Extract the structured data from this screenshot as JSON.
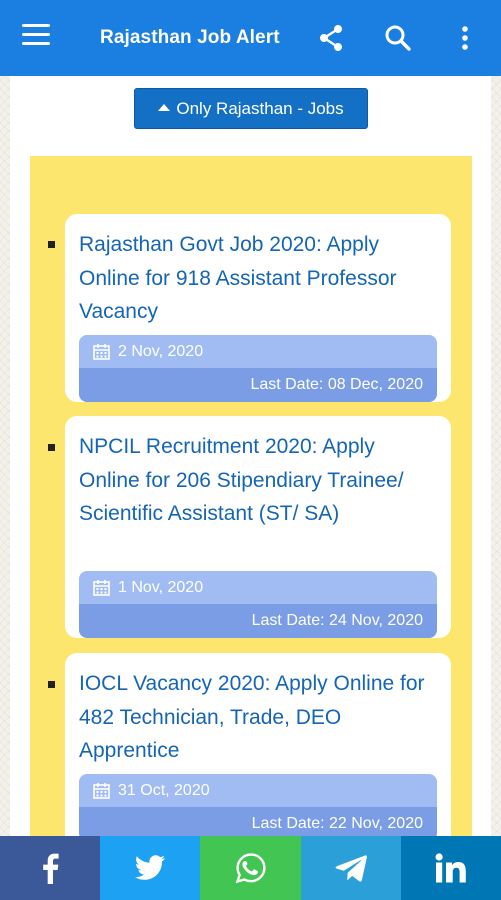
{
  "appbar": {
    "title": "Rajasthan Job Alert",
    "icons": [
      "menu-icon",
      "share-icon",
      "search-icon",
      "more-vert-icon"
    ],
    "color": "#1a7fe0"
  },
  "filter": {
    "label": "Only Rajasthan - Jobs",
    "color": "#1470c4"
  },
  "panel_color": "#fde66d",
  "jobs": [
    {
      "title": "Rajasthan Govt Job 2020: Apply Online for 918 Assistant Professor Vacancy",
      "posted": "2 Nov, 2020",
      "last_date": "Last Date: 08 Dec, 2020"
    },
    {
      "title": "NPCIL Recruitment 2020: Apply Online for 206 Stipendiary Trainee/ Scientific Assistant (ST/ SA)",
      "posted": "1 Nov, 2020",
      "last_date": "Last Date: 24 Nov, 2020"
    },
    {
      "title": "IOCL Vacancy 2020: Apply Online for 482 Technician, Trade, DEO Apprentice",
      "posted": "31 Oct, 2020",
      "last_date": "Last Date: 22 Nov, 2020"
    }
  ],
  "share_bar": [
    {
      "name": "facebook",
      "icon": "facebook-icon",
      "color": "#3b5998"
    },
    {
      "name": "twitter",
      "icon": "twitter-icon",
      "color": "#1da1f2"
    },
    {
      "name": "whatsapp",
      "icon": "whatsapp-icon",
      "color": "#43c553"
    },
    {
      "name": "telegram",
      "icon": "telegram-icon",
      "color": "#2b9fd8"
    },
    {
      "name": "linkedin",
      "icon": "linkedin-icon",
      "color": "#0077b5"
    }
  ]
}
